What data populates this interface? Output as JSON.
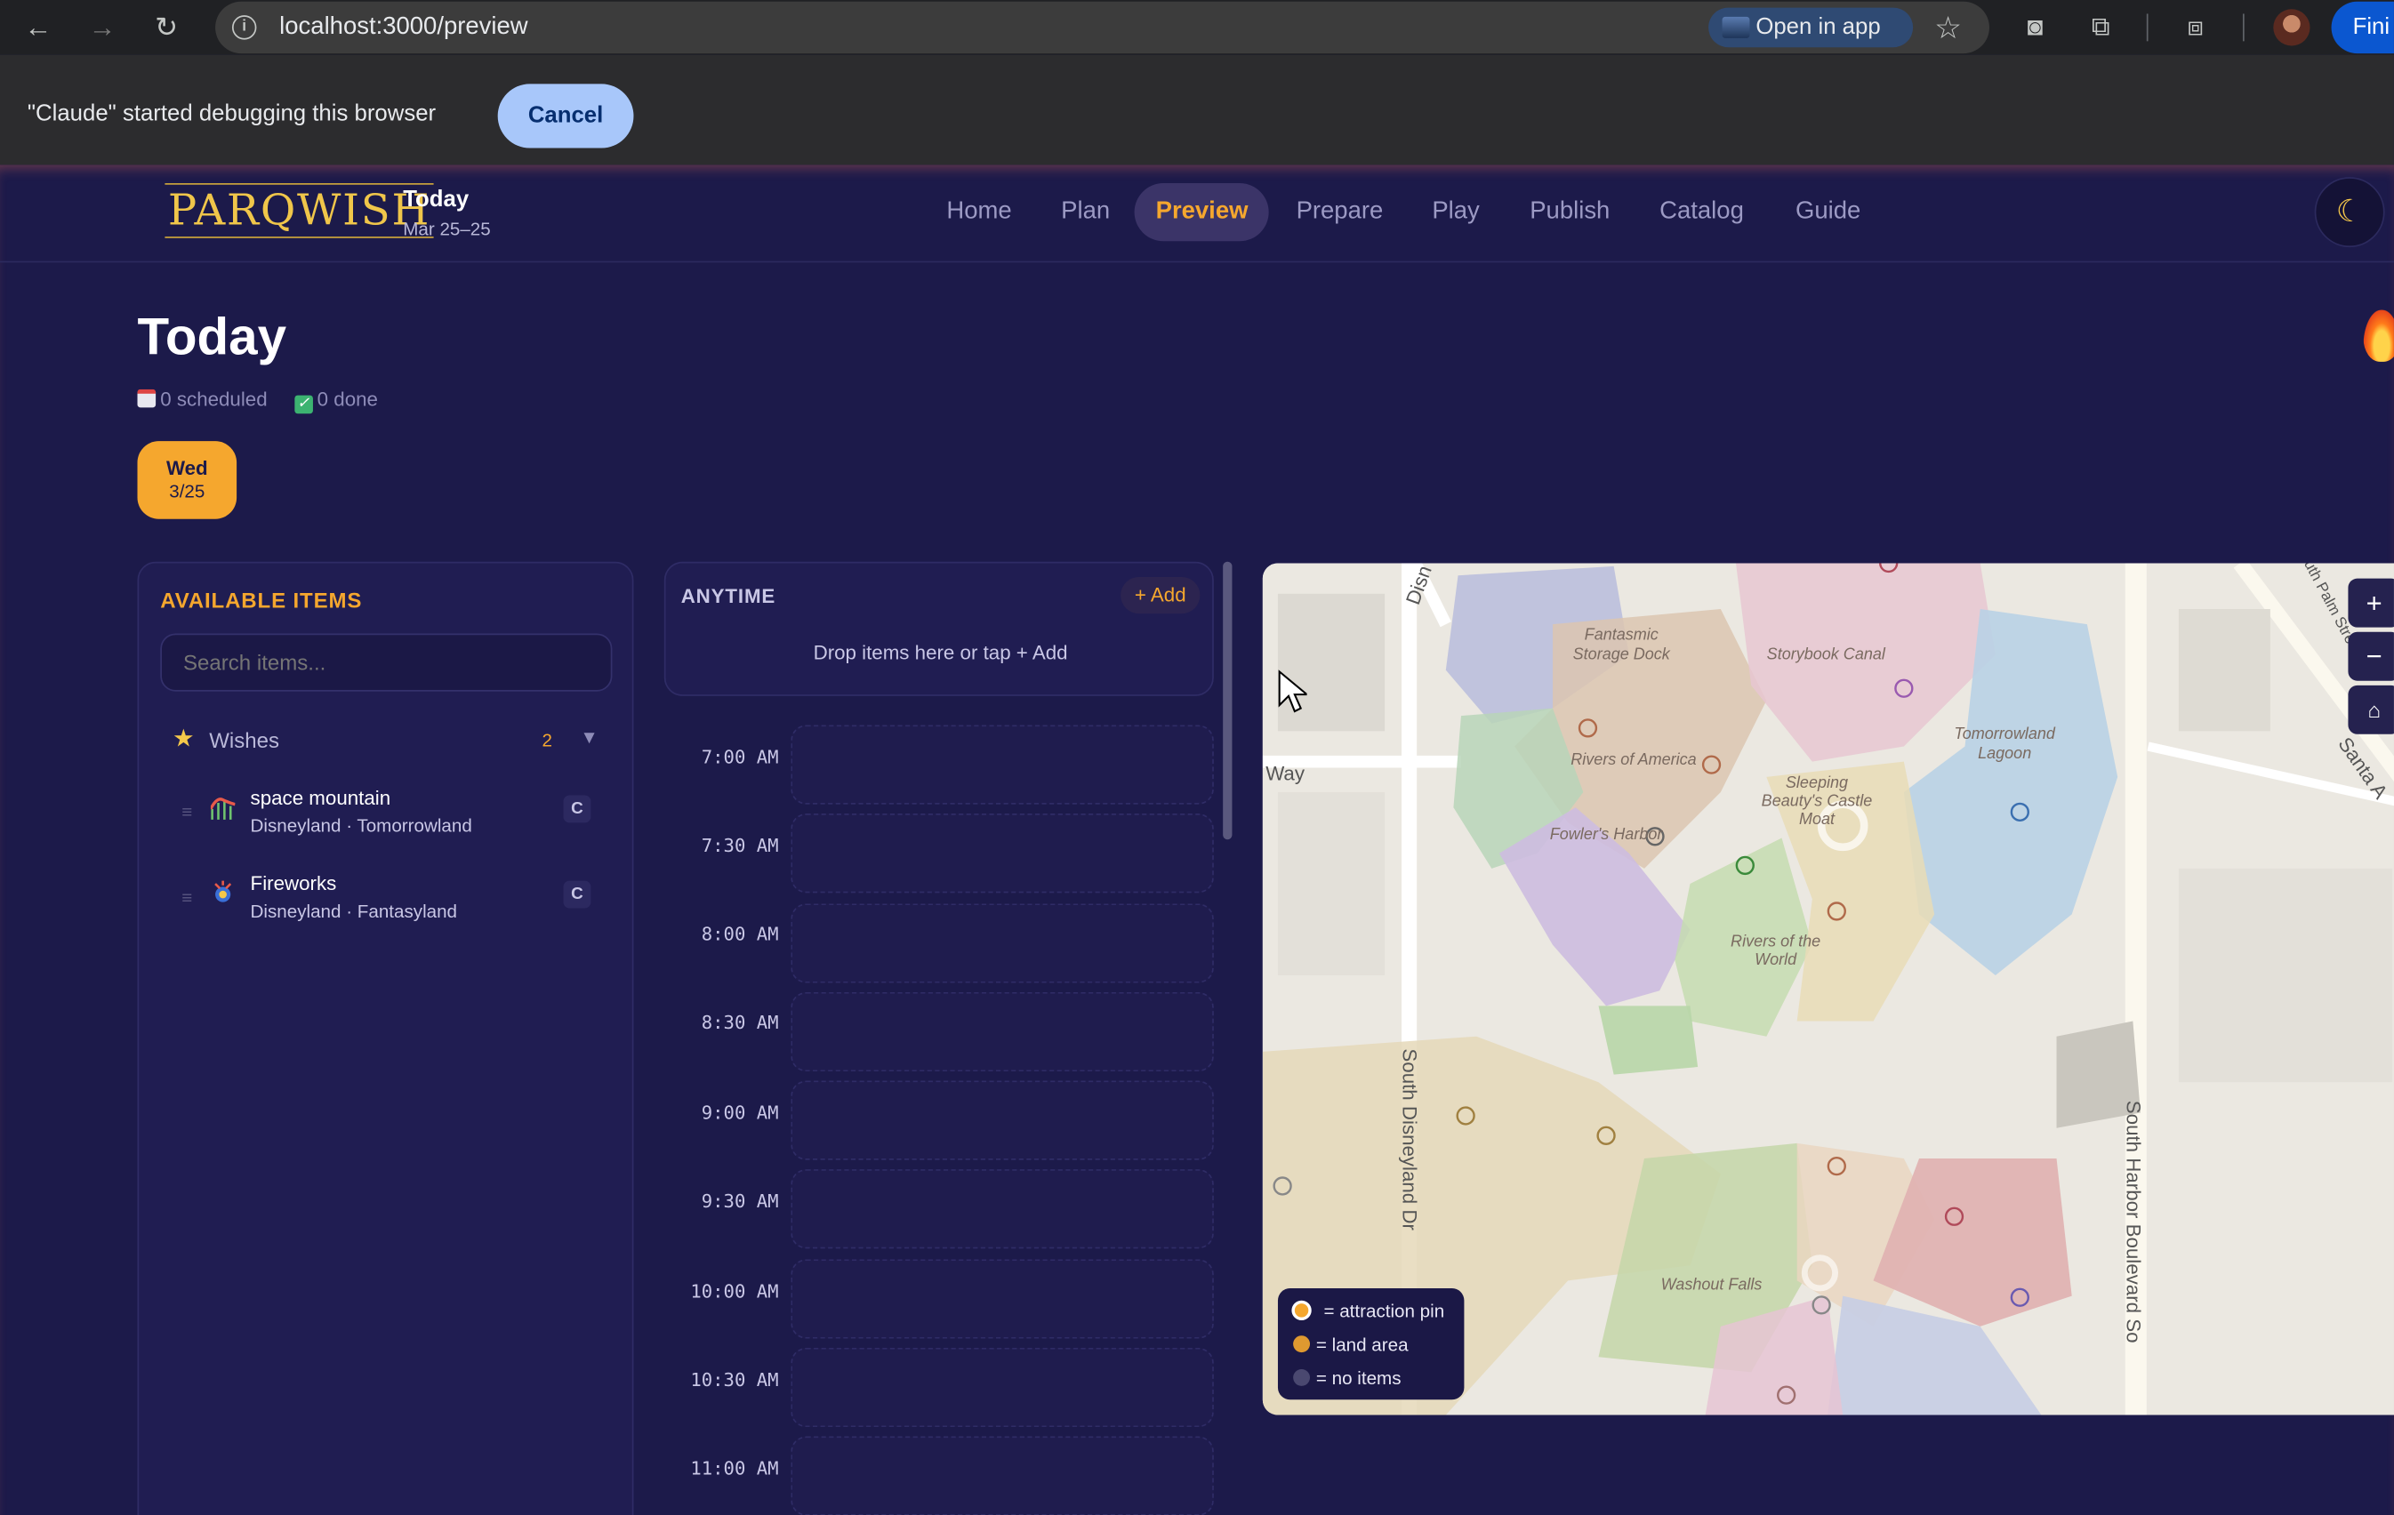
{
  "browser": {
    "url": "localhost:3000/preview",
    "open_in_app": "Open in app",
    "finish_label": "Fini",
    "debug_message": "\"Claude\" started debugging this browser",
    "cancel_label": "Cancel"
  },
  "app": {
    "logo": "PARQWISH",
    "title": "Today",
    "date_range": "Mar 25–25",
    "nav": [
      "Home",
      "Plan",
      "Preview",
      "Prepare",
      "Play",
      "Publish",
      "Catalog",
      "Guide"
    ],
    "active_nav": "Preview",
    "theme_icon": "moon-icon"
  },
  "page": {
    "title": "Today",
    "scheduled": "0 scheduled",
    "done": "0 done",
    "day": {
      "weekday": "Wed",
      "date": "3/25"
    }
  },
  "available": {
    "heading": "AVAILABLE ITEMS",
    "search_placeholder": "Search items...",
    "group": {
      "label": "Wishes",
      "count": "2"
    },
    "items": [
      {
        "name": "space mountain",
        "location": "Disneyland · Tomorrowland",
        "badge": "C",
        "icon": "rollercoaster-icon"
      },
      {
        "name": "Fireworks",
        "location": "Disneyland · Fantasyland",
        "badge": "C",
        "icon": "fireworks-icon"
      }
    ]
  },
  "schedule": {
    "anytime_heading": "ANYTIME",
    "add_label": "+ Add",
    "drop_hint": "Drop items here or tap + Add",
    "slots": [
      "7:00 AM",
      "7:30 AM",
      "8:00 AM",
      "8:30 AM",
      "9:00 AM",
      "9:30 AM",
      "10:00 AM",
      "10:30 AM",
      "11:00 AM"
    ]
  },
  "map": {
    "labels": {
      "fantasmic": "Fantasmic",
      "storage": "Storage Dock",
      "storybook": "Storybook Canal",
      "tomorrowland1": "Tomorrowland",
      "tomorrowland2": "Lagoon",
      "rivers_america": "Rivers of America",
      "sleeping1": "Sleeping",
      "sleeping2": "Beauty's Castle",
      "sleeping3": "Moat",
      "fowlers": "Fowler's Harbor",
      "rivers_world1": "Rivers of the",
      "rivers_world2": "World",
      "washout": "Washout Falls",
      "way": "Way",
      "disn": "Disn",
      "s_disneyland": "South Disneyland Dr",
      "s_harbor": "South Harbor Boulevard So",
      "palm": "uth Palm Stree",
      "santa": "Santa A"
    },
    "zoom_in": "+",
    "zoom_out": "−",
    "home": "⌂",
    "legend": [
      {
        "text": "= attraction pin",
        "color": "#f5a72e"
      },
      {
        "text": "= land area",
        "color": "#f5a72e"
      },
      {
        "text": "= no items",
        "color": "#4a4870"
      }
    ]
  }
}
